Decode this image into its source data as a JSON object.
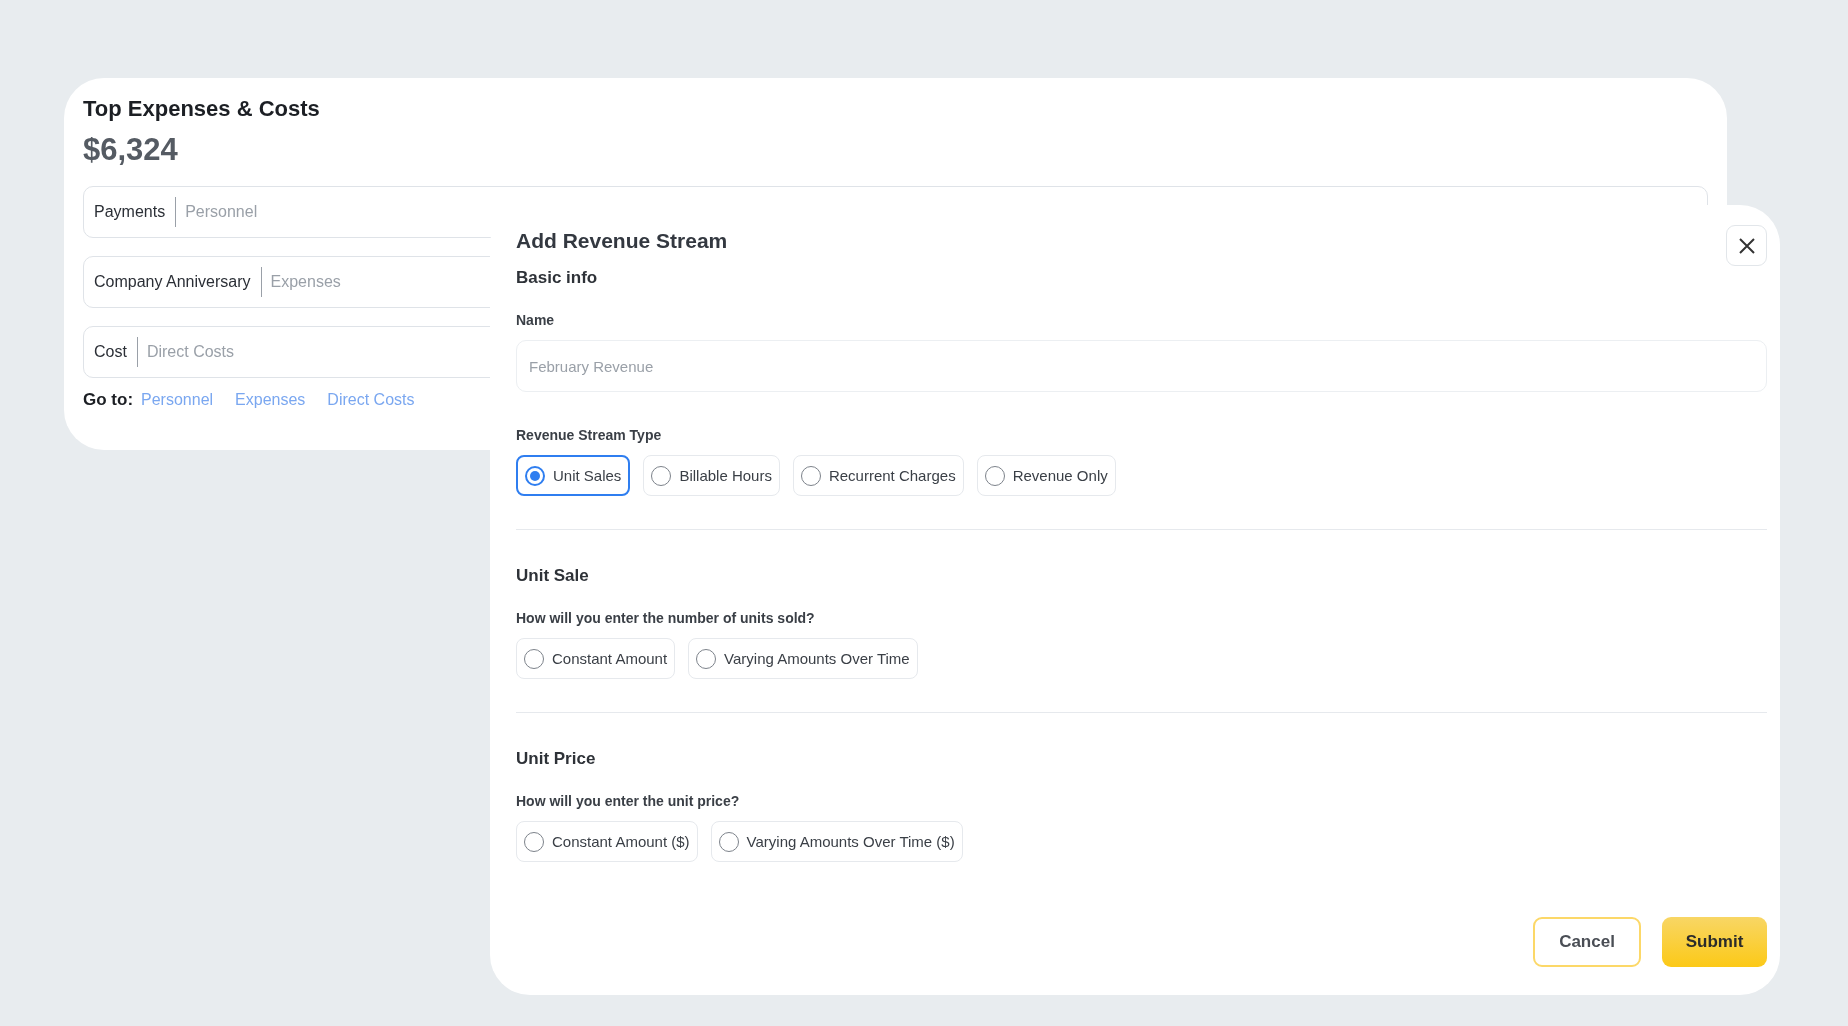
{
  "expenses_card": {
    "title": "Top Expenses & Costs",
    "total": "$6,324",
    "rows": [
      {
        "name": "Payments",
        "category": "Personnel"
      },
      {
        "name": "Company Anniversary",
        "category": "Expenses"
      },
      {
        "name": "Cost",
        "category": "Direct Costs"
      }
    ],
    "goto": {
      "label": "Go to:",
      "links": [
        "Personnel",
        "Expenses",
        "Direct Costs"
      ]
    }
  },
  "dialog": {
    "title": "Add Revenue Stream",
    "basic_info": {
      "heading": "Basic info",
      "name_label": "Name",
      "name_placeholder": "February Revenue"
    },
    "type": {
      "label": "Revenue Stream Type",
      "options": [
        {
          "label": "Unit Sales",
          "selected": true
        },
        {
          "label": "Billable Hours",
          "selected": false
        },
        {
          "label": "Recurrent Charges",
          "selected": false
        },
        {
          "label": "Revenue Only",
          "selected": false
        }
      ]
    },
    "sections": [
      {
        "heading": "Unit Sale",
        "question": "How will you enter the number of units sold?",
        "options": [
          {
            "label": "Constant Amount",
            "selected": false
          },
          {
            "label": "Varying Amounts Over Time",
            "selected": false
          }
        ]
      },
      {
        "heading": "Unit Price",
        "question": "How will you enter the unit price?",
        "options": [
          {
            "label": "Constant Amount ($)",
            "selected": false
          },
          {
            "label": "Varying Amounts Over Time ($)",
            "selected": false
          }
        ]
      }
    ],
    "buttons": {
      "cancel": "Cancel",
      "submit": "Submit"
    }
  }
}
